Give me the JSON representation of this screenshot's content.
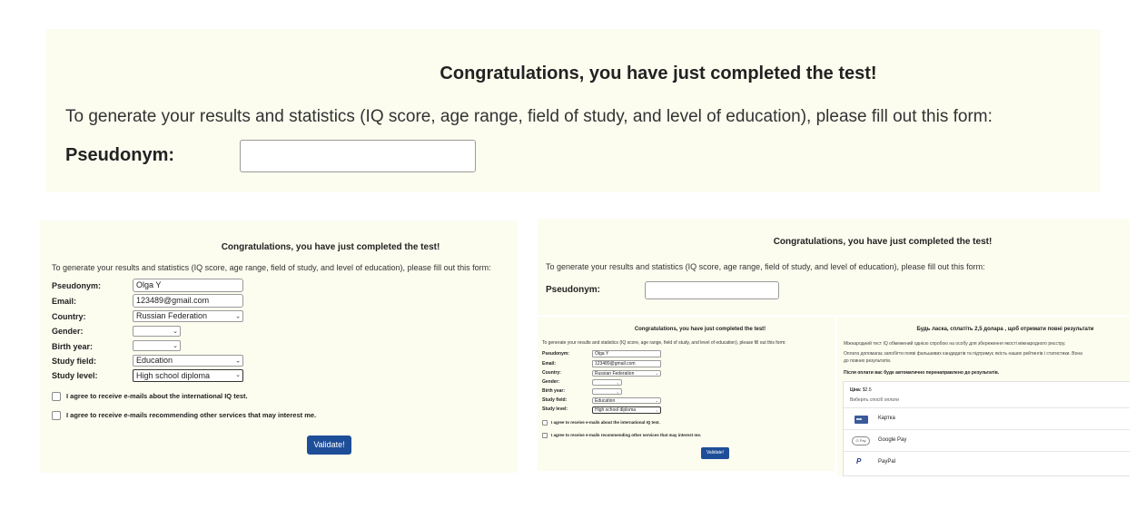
{
  "top": {
    "title": "Congratulations, you have just completed the test!",
    "intro": "To generate your results and statistics (IQ score, age range, field of study, and level of education), please fill out this form:",
    "pseudonym_label": "Pseudonym:",
    "pseudonym_value": ""
  },
  "left": {
    "title": "Congratulations, you have just completed the test!",
    "intro": "To generate your results and statistics (IQ score, age range, field of study, and level of education), please fill out this form:",
    "fields": {
      "pseudonym": {
        "label": "Pseudonym:",
        "value": "Olga Y"
      },
      "email": {
        "label": "Email:",
        "value": "123489@gmail.com"
      },
      "country": {
        "label": "Country:",
        "value": "Russian Federation"
      },
      "gender": {
        "label": "Gender:",
        "value": ""
      },
      "birth_year": {
        "label": "Birth year:",
        "value": ""
      },
      "study_field": {
        "label": "Study field:",
        "value": "Education"
      },
      "study_level": {
        "label": "Study level:",
        "value": "High school diploma"
      }
    },
    "consent1": "I agree to receive e-mails about the international IQ test.",
    "consent2": "I agree to receive e-mails recommending other services that may interest me.",
    "validate_label": "Validate!"
  },
  "right": {
    "title": "Congratulations, you have just completed the test!",
    "intro": "To generate your results and statistics (IQ score, age range, field of study, and level of education), please fill out this form:",
    "pseudonym_label": "Pseudonym:",
    "pseudonym_value": "",
    "inner_form": {
      "title": "Congratulations, you have just completed the test!",
      "intro": "To generate your results and statistics (IQ score, age range, field of study, and level of education), please fill out this form:",
      "fields": {
        "pseudonym": {
          "label": "Pseudonym:",
          "value": "Olga Y"
        },
        "email": {
          "label": "Email:",
          "value": "123489@gmail.com"
        },
        "country": {
          "label": "Country:",
          "value": "Russian Federation"
        },
        "gender": {
          "label": "Gender:",
          "value": ""
        },
        "birth_year": {
          "label": "Birth year:",
          "value": ""
        },
        "study_field": {
          "label": "Study field:",
          "value": "Education"
        },
        "study_level": {
          "label": "Study level:",
          "value": "High school diploma"
        }
      },
      "consent1": "I agree to receive e-mails about the international IQ test.",
      "consent2": "I agree to receive e-mails recommending other services that may interest me.",
      "validate_label": "Validate!"
    },
    "payment": {
      "title": "Будь ласка, сплатіть 2,5 долара , щоб отримати повні результати",
      "line1": "Міжнародний тест IQ обмежений однією спробою на особу для збереження якості міжнародного реєстру.",
      "line2": "Оплата допомагає запобігти появі фальшивих кандидатів та підтримує якість наших рейтингів і статистики. Вона",
      "line3": "до повних результатів.",
      "redirect": "Після оплати вас буде автоматично перенаправлено до результатів.",
      "price_label": "Ціна:",
      "price_value": "$2.5",
      "choose_method": "Виберіть спосіб оплати",
      "options": [
        {
          "label": "Картка",
          "icon": "card-icon"
        },
        {
          "label": "Google Pay",
          "icon": "google-pay-icon"
        },
        {
          "label": "PayPal",
          "icon": "paypal-icon"
        }
      ]
    }
  },
  "colors": {
    "panel_bg": "#fcfdef",
    "button_bg": "#1f4e99",
    "paypal_blue": "#253b80"
  }
}
